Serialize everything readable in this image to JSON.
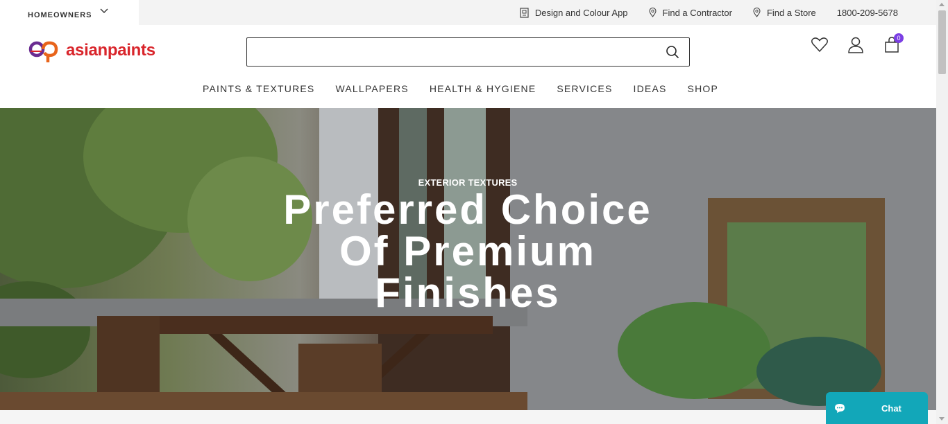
{
  "utility_bar": {
    "segment_label": "HOMEOWNERS",
    "links": [
      {
        "label": "Design and Colour App",
        "icon": "app-icon"
      },
      {
        "label": "Find a Contractor",
        "icon": "location-pin-icon"
      },
      {
        "label": "Find a Store",
        "icon": "location-pin-icon"
      }
    ],
    "phone": "1800-209-5678"
  },
  "header": {
    "logo_text": "asianpaints",
    "search_placeholder": "",
    "cart_count": "0"
  },
  "nav": {
    "items": [
      "PAINTS & TEXTURES",
      "WALLPAPERS",
      "HEALTH & HYGIENE",
      "SERVICES",
      "IDEAS",
      "SHOP"
    ]
  },
  "hero": {
    "kicker": "EXTERIOR TEXTURES",
    "title_lines": [
      "Preferred Choice",
      "Of Premium",
      "Finishes"
    ]
  },
  "chat": {
    "label": "Chat"
  },
  "colors": {
    "brand_red": "#d9252b",
    "accent_purple": "#7b3fe4",
    "chat_teal": "#12a7b9"
  }
}
